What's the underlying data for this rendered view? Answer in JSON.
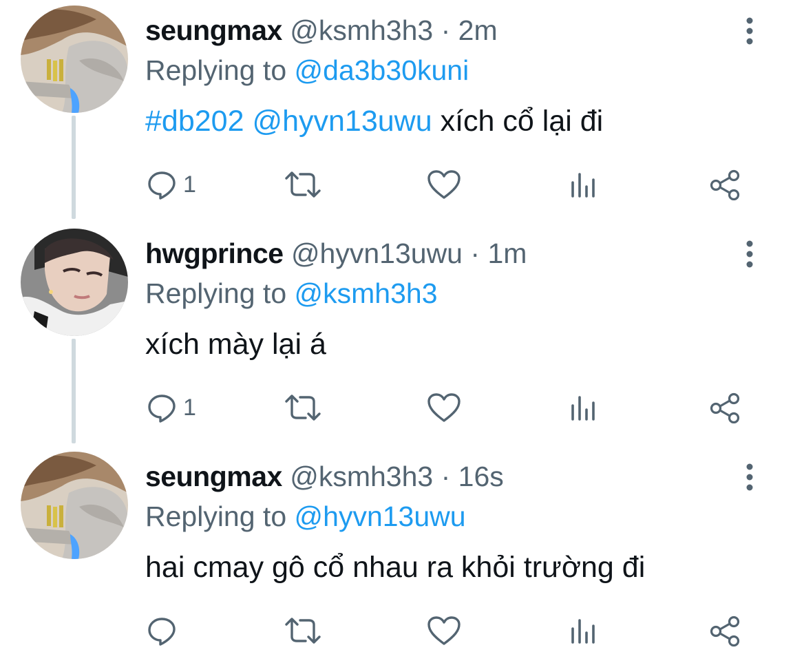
{
  "tweets": [
    {
      "display_name": "seungmax",
      "handle": "@ksmh3h3",
      "separator": "·",
      "time": "2m",
      "replying_label": "Replying to",
      "replying_to": "@da3b30kuni",
      "text_hashtag": "#db202",
      "text_mention": "@hyvn13uwu",
      "text": "xích cổ lại đi",
      "reply_count": "1",
      "avatar": "avatar-seungmax"
    },
    {
      "display_name": "hwgprince",
      "handle": "@hyvn13uwu",
      "separator": "·",
      "time": "1m",
      "replying_label": "Replying to",
      "replying_to": "@ksmh3h3",
      "text": "xích mày lại á",
      "reply_count": "1",
      "avatar": "avatar-hwgprince"
    },
    {
      "display_name": "seungmax",
      "handle": "@ksmh3h3",
      "separator": "·",
      "time": "16s",
      "replying_label": "Replying to",
      "replying_to": "@hyvn13uwu",
      "text": "hai cmay gô cổ nhau ra khỏi trường đi",
      "reply_count": "",
      "avatar": "avatar-seungmax"
    }
  ],
  "icons": {
    "reply": "reply-icon",
    "retweet": "retweet-icon",
    "like": "heart-icon",
    "views": "analytics-icon",
    "share": "share-icon",
    "more": "more-vertical-icon"
  },
  "colors": {
    "link": "#1d9bf0",
    "secondary_text": "#536471",
    "primary_text": "#0f1419",
    "thread_line": "#cfd9de"
  }
}
